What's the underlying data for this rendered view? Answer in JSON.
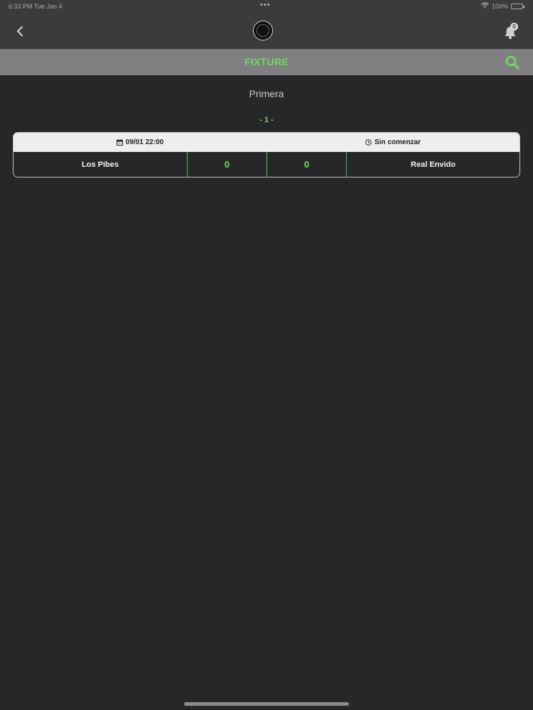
{
  "status_bar": {
    "time_date": "6:33 PM   Tue Jan 4",
    "battery": "100%"
  },
  "nav": {
    "back_icon": "chevron-left-icon",
    "logo_icon": "club-logo",
    "notifications_count": "0"
  },
  "title_bar": {
    "title": "FIXTURE",
    "search_icon": "search-icon"
  },
  "content": {
    "category": "Primera",
    "round_label": "- 1 -",
    "matches": [
      {
        "datetime": "09/01 22:00",
        "status": "Sin comenzar",
        "home_team": "Los Pibes",
        "home_score": "0",
        "away_score": "0",
        "away_team": "Real Envido"
      }
    ]
  },
  "colors": {
    "accent": "#6bdc5d",
    "background": "#272729",
    "topbar": "#3b3b3d",
    "titlebar": "#808082"
  }
}
